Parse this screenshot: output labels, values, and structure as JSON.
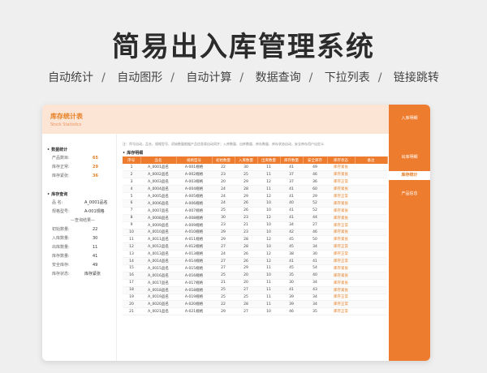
{
  "hero": {
    "title": "简易出入库管理系统",
    "features": [
      "自动统计",
      "自动图形",
      "自动计算",
      "数据查询",
      "下拉列表",
      "链接跳转"
    ],
    "separator": "/"
  },
  "card": {
    "title": "库存统计表",
    "subtitle": "Stock Statistics"
  },
  "nav": {
    "items": [
      "入库明细",
      "出库明细",
      "库存统计",
      "产品信息"
    ],
    "active_index": 2
  },
  "summary": {
    "title": "数据统计",
    "rows": [
      {
        "label": "产品数目:",
        "value": "65"
      },
      {
        "label": "库存正常:",
        "value": "29"
      },
      {
        "label": "库存紧张:",
        "value": "36"
      }
    ]
  },
  "query": {
    "title": "库存查询",
    "name_label": "品 名:",
    "name_value": "A_0001品名",
    "spec_label": "规格型号:",
    "spec_value": "A-001规格",
    "result_label": "—查询结果—",
    "rows": [
      {
        "label": "初始数量:",
        "value": "22"
      },
      {
        "label": "入库数量:",
        "value": "30"
      },
      {
        "label": "出库数量:",
        "value": "11"
      },
      {
        "label": "库存数量:",
        "value": "41"
      },
      {
        "label": "安全库存:",
        "value": "49"
      },
      {
        "label": "库存状态:",
        "value": "库存紧张"
      }
    ]
  },
  "detail": {
    "note": "注：序号自动，品名、规格型号、初始数量根据产品信息表自动同步；入库数量、出库数量、库存数量、库存状态自动，安全库存用户自定义",
    "title": "库存明细",
    "columns": [
      "序号",
      "品名",
      "规格型号",
      "初始数量",
      "入库数量",
      "出库数量",
      "库存数量",
      "安全库存",
      "库存状态",
      "备注"
    ],
    "rows": [
      [
        "1",
        "A_0001品名",
        "A-001规格",
        "22",
        "30",
        "11",
        "41",
        "49",
        "库存紧张",
        ""
      ],
      [
        "2",
        "A_0002品名",
        "A-002规格",
        "23",
        "25",
        "11",
        "37",
        "46",
        "库存紧张",
        ""
      ],
      [
        "3",
        "A_0003品名",
        "A-003规格",
        "20",
        "29",
        "12",
        "37",
        "36",
        "库存正常",
        ""
      ],
      [
        "4",
        "A_0004品名",
        "A-004规格",
        "24",
        "28",
        "11",
        "41",
        "60",
        "库存紧张",
        ""
      ],
      [
        "5",
        "A_0005品名",
        "A-005规格",
        "24",
        "29",
        "12",
        "41",
        "29",
        "库存正常",
        ""
      ],
      [
        "6",
        "A_0006品名",
        "A-006规格",
        "24",
        "26",
        "10",
        "40",
        "52",
        "库存紧张",
        ""
      ],
      [
        "7",
        "A_0007品名",
        "A-007规格",
        "25",
        "26",
        "10",
        "41",
        "52",
        "库存紧张",
        ""
      ],
      [
        "8",
        "A_0008品名",
        "A-008规格",
        "30",
        "23",
        "12",
        "41",
        "44",
        "库存紧张",
        ""
      ],
      [
        "9",
        "A_0009品名",
        "A-009规格",
        "23",
        "21",
        "10",
        "34",
        "27",
        "库存正常",
        ""
      ],
      [
        "10",
        "A_0010品名",
        "A-010规格",
        "29",
        "23",
        "10",
        "42",
        "46",
        "库存紧张",
        ""
      ],
      [
        "11",
        "A_0011品名",
        "A-011规格",
        "29",
        "28",
        "12",
        "45",
        "50",
        "库存紧张",
        ""
      ],
      [
        "12",
        "A_0012品名",
        "A-012规格",
        "27",
        "28",
        "10",
        "45",
        "34",
        "库存正常",
        ""
      ],
      [
        "13",
        "A_0013品名",
        "A-013规格",
        "24",
        "26",
        "12",
        "38",
        "30",
        "库存正常",
        ""
      ],
      [
        "14",
        "A_0014品名",
        "A-014规格",
        "27",
        "26",
        "12",
        "41",
        "41",
        "库存正常",
        ""
      ],
      [
        "15",
        "A_0015品名",
        "A-015规格",
        "27",
        "29",
        "11",
        "45",
        "54",
        "库存紧张",
        ""
      ],
      [
        "16",
        "A_0016品名",
        "A-016规格",
        "25",
        "20",
        "10",
        "35",
        "40",
        "库存紧张",
        ""
      ],
      [
        "17",
        "A_0017品名",
        "A-017规格",
        "21",
        "20",
        "11",
        "30",
        "34",
        "库存紧张",
        ""
      ],
      [
        "18",
        "A_0018品名",
        "A-018规格",
        "25",
        "27",
        "11",
        "41",
        "43",
        "库存紧张",
        ""
      ],
      [
        "19",
        "A_0019品名",
        "A-019规格",
        "25",
        "25",
        "11",
        "39",
        "34",
        "库存正常",
        ""
      ],
      [
        "20",
        "A_0020品名",
        "A-020规格",
        "22",
        "28",
        "11",
        "39",
        "34",
        "库存正常",
        ""
      ],
      [
        "21",
        "A_0021品名",
        "A-021规格",
        "29",
        "27",
        "10",
        "46",
        "35",
        "库存正常",
        ""
      ]
    ]
  },
  "colors": {
    "accent": "#ee7c2e",
    "header_bg": "#fde5d5"
  }
}
